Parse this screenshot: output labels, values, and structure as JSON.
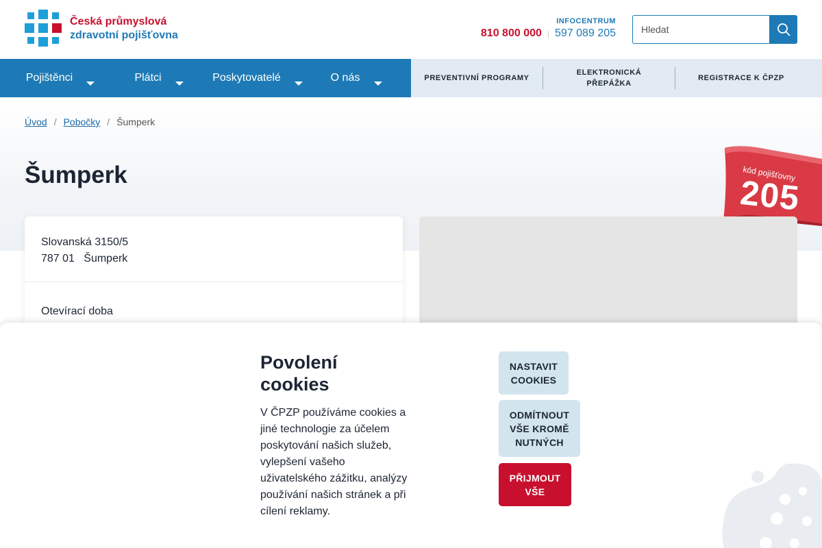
{
  "logo": {
    "line1": "Česká průmyslová",
    "line2": "zdravotní pojišťovna"
  },
  "header": {
    "infocentrum_label": "INFOCENTRUM",
    "phone_main": "810 800 000",
    "phone_separator": "|",
    "phone_alt": "597 089 205",
    "search_placeholder": "Hledat",
    "search_icon": "search-icon"
  },
  "nav": {
    "main": [
      {
        "label": "Pojištěnci"
      },
      {
        "label": "Plátci"
      },
      {
        "label": "Poskytovatelé"
      },
      {
        "label": "O nás"
      }
    ],
    "secondary": [
      {
        "label": "PREVENTIVNÍ PROGRAMY"
      },
      {
        "label": "ELEKTRONICKÁ PŘEPÁŽKA"
      },
      {
        "label": "REGISTRACE K ČPZP"
      }
    ]
  },
  "breadcrumb": {
    "items": [
      "Úvod",
      "Pobočky"
    ],
    "separator": "/",
    "current": "Šumperk"
  },
  "page": {
    "title": "Šumperk"
  },
  "ribbon": {
    "label": "kód pojišťovny",
    "code": "205"
  },
  "branch": {
    "street": "Slovanská 3150/5",
    "zip": "787 01",
    "city": "Šumperk",
    "hours_label": "Otevírací doba"
  },
  "cookies": {
    "title": "Povolení cookies",
    "text": "V ČPZP používáme cookies a jiné technologie za účelem poskytování našich služeb, vylepšení vašeho uživatelského zážitku, analýzy používání našich stránek a při cílení reklamy.",
    "btn_settings": "NASTAVIT COOKIES",
    "btn_reject": "ODMÍTNOUT VŠE KROMĚ NUTNÝCH",
    "btn_accept": "PŘIJMOUT VŠE"
  },
  "colors": {
    "brand_blue": "#1e7ab6",
    "brand_red": "#c8102e",
    "nav_secondary_bg": "#e2ebf3",
    "cookie_button_light": "#d2e4ee"
  }
}
